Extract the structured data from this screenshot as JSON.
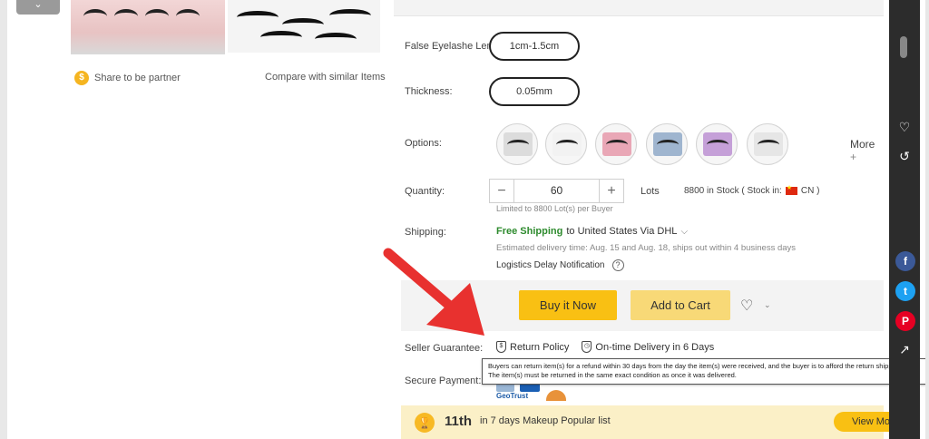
{
  "gallery": {
    "collapse_icon": "chevron-down-icon",
    "share_label": "Share to be partner",
    "compare_label": "Compare with similar Items"
  },
  "product": {
    "length": {
      "label": "False Eyelashe Length:",
      "value": "1cm-1.5cm"
    },
    "thickness": {
      "label": "Thickness:",
      "value": "0.05mm"
    },
    "options": {
      "label": "Options:",
      "count": 6,
      "more_label": "More",
      "more_icon": "plus-icon"
    },
    "quantity": {
      "label": "Quantity:",
      "minus": "−",
      "value": "60",
      "plus": "+",
      "unit": "Lots",
      "stock_text": "8800 in Stock ( Stock in:",
      "stock_country": "CN )",
      "limit_text": "Limited to 8800 Lot(s) per Buyer"
    },
    "shipping": {
      "label": "Shipping:",
      "free": "Free Shipping",
      "destination": "to  United States Via DHL",
      "estimate": "Estimated delivery time: Aug. 15 and Aug. 18, ships out within 4 business days",
      "delay": "Logistics Delay Notification"
    },
    "actions": {
      "buy_now": "Buy it Now",
      "add_to_cart": "Add to Cart"
    },
    "guarantee": {
      "label": "Seller Guarantee:",
      "return_policy": "Return Policy",
      "delivery": "On-time Delivery in 6 Days"
    },
    "payment": {
      "label": "Secure Payment:",
      "geotrust": "GeoTrust"
    },
    "tooltip": "Buyers can return item(s) for a refund within 30 days from the day the item(s) were received, and the buyer is to afford the return shipping cost. The item(s) must be returned in the same exact condition as once it was delivered.",
    "popular": {
      "rank": "11th",
      "text": "in 7 days Makeup Popular list",
      "view_more": "View Mo"
    }
  },
  "side_rail": {
    "icons": [
      "heart-icon",
      "history-icon"
    ],
    "social": [
      "facebook-icon",
      "twitter-icon",
      "pinterest-icon",
      "share-icon"
    ]
  },
  "colors": {
    "accent_yellow": "#f9c013",
    "cart_yellow": "#f8d977",
    "free_shipping_green": "#2e8b2e",
    "arrow_red": "#e8312f",
    "rail_dark": "#2c2c2c"
  }
}
